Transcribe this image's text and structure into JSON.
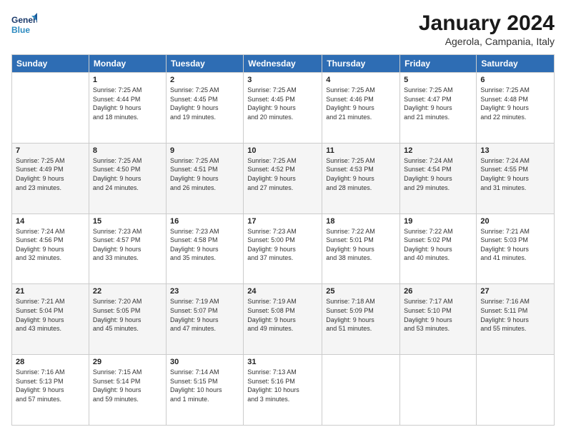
{
  "logo": {
    "line1": "General",
    "line2": "Blue"
  },
  "title": "January 2024",
  "subtitle": "Agerola, Campania, Italy",
  "days_of_week": [
    "Sunday",
    "Monday",
    "Tuesday",
    "Wednesday",
    "Thursday",
    "Friday",
    "Saturday"
  ],
  "weeks": [
    [
      {
        "day": "",
        "info": ""
      },
      {
        "day": "1",
        "info": "Sunrise: 7:25 AM\nSunset: 4:44 PM\nDaylight: 9 hours\nand 18 minutes."
      },
      {
        "day": "2",
        "info": "Sunrise: 7:25 AM\nSunset: 4:45 PM\nDaylight: 9 hours\nand 19 minutes."
      },
      {
        "day": "3",
        "info": "Sunrise: 7:25 AM\nSunset: 4:45 PM\nDaylight: 9 hours\nand 20 minutes."
      },
      {
        "day": "4",
        "info": "Sunrise: 7:25 AM\nSunset: 4:46 PM\nDaylight: 9 hours\nand 21 minutes."
      },
      {
        "day": "5",
        "info": "Sunrise: 7:25 AM\nSunset: 4:47 PM\nDaylight: 9 hours\nand 21 minutes."
      },
      {
        "day": "6",
        "info": "Sunrise: 7:25 AM\nSunset: 4:48 PM\nDaylight: 9 hours\nand 22 minutes."
      }
    ],
    [
      {
        "day": "7",
        "info": "Sunrise: 7:25 AM\nSunset: 4:49 PM\nDaylight: 9 hours\nand 23 minutes."
      },
      {
        "day": "8",
        "info": "Sunrise: 7:25 AM\nSunset: 4:50 PM\nDaylight: 9 hours\nand 24 minutes."
      },
      {
        "day": "9",
        "info": "Sunrise: 7:25 AM\nSunset: 4:51 PM\nDaylight: 9 hours\nand 26 minutes."
      },
      {
        "day": "10",
        "info": "Sunrise: 7:25 AM\nSunset: 4:52 PM\nDaylight: 9 hours\nand 27 minutes."
      },
      {
        "day": "11",
        "info": "Sunrise: 7:25 AM\nSunset: 4:53 PM\nDaylight: 9 hours\nand 28 minutes."
      },
      {
        "day": "12",
        "info": "Sunrise: 7:24 AM\nSunset: 4:54 PM\nDaylight: 9 hours\nand 29 minutes."
      },
      {
        "day": "13",
        "info": "Sunrise: 7:24 AM\nSunset: 4:55 PM\nDaylight: 9 hours\nand 31 minutes."
      }
    ],
    [
      {
        "day": "14",
        "info": "Sunrise: 7:24 AM\nSunset: 4:56 PM\nDaylight: 9 hours\nand 32 minutes."
      },
      {
        "day": "15",
        "info": "Sunrise: 7:23 AM\nSunset: 4:57 PM\nDaylight: 9 hours\nand 33 minutes."
      },
      {
        "day": "16",
        "info": "Sunrise: 7:23 AM\nSunset: 4:58 PM\nDaylight: 9 hours\nand 35 minutes."
      },
      {
        "day": "17",
        "info": "Sunrise: 7:23 AM\nSunset: 5:00 PM\nDaylight: 9 hours\nand 37 minutes."
      },
      {
        "day": "18",
        "info": "Sunrise: 7:22 AM\nSunset: 5:01 PM\nDaylight: 9 hours\nand 38 minutes."
      },
      {
        "day": "19",
        "info": "Sunrise: 7:22 AM\nSunset: 5:02 PM\nDaylight: 9 hours\nand 40 minutes."
      },
      {
        "day": "20",
        "info": "Sunrise: 7:21 AM\nSunset: 5:03 PM\nDaylight: 9 hours\nand 41 minutes."
      }
    ],
    [
      {
        "day": "21",
        "info": "Sunrise: 7:21 AM\nSunset: 5:04 PM\nDaylight: 9 hours\nand 43 minutes."
      },
      {
        "day": "22",
        "info": "Sunrise: 7:20 AM\nSunset: 5:05 PM\nDaylight: 9 hours\nand 45 minutes."
      },
      {
        "day": "23",
        "info": "Sunrise: 7:19 AM\nSunset: 5:07 PM\nDaylight: 9 hours\nand 47 minutes."
      },
      {
        "day": "24",
        "info": "Sunrise: 7:19 AM\nSunset: 5:08 PM\nDaylight: 9 hours\nand 49 minutes."
      },
      {
        "day": "25",
        "info": "Sunrise: 7:18 AM\nSunset: 5:09 PM\nDaylight: 9 hours\nand 51 minutes."
      },
      {
        "day": "26",
        "info": "Sunrise: 7:17 AM\nSunset: 5:10 PM\nDaylight: 9 hours\nand 53 minutes."
      },
      {
        "day": "27",
        "info": "Sunrise: 7:16 AM\nSunset: 5:11 PM\nDaylight: 9 hours\nand 55 minutes."
      }
    ],
    [
      {
        "day": "28",
        "info": "Sunrise: 7:16 AM\nSunset: 5:13 PM\nDaylight: 9 hours\nand 57 minutes."
      },
      {
        "day": "29",
        "info": "Sunrise: 7:15 AM\nSunset: 5:14 PM\nDaylight: 9 hours\nand 59 minutes."
      },
      {
        "day": "30",
        "info": "Sunrise: 7:14 AM\nSunset: 5:15 PM\nDaylight: 10 hours\nand 1 minute."
      },
      {
        "day": "31",
        "info": "Sunrise: 7:13 AM\nSunset: 5:16 PM\nDaylight: 10 hours\nand 3 minutes."
      },
      {
        "day": "",
        "info": ""
      },
      {
        "day": "",
        "info": ""
      },
      {
        "day": "",
        "info": ""
      }
    ]
  ]
}
